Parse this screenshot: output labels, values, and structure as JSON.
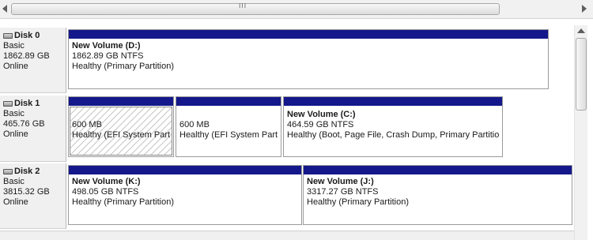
{
  "icons": {
    "scroll_grip": "grip-icon",
    "drive": "hard-disk-icon"
  },
  "hscroll": {
    "grip": "III"
  },
  "disks": [
    {
      "name": "Disk 0",
      "type": "Basic",
      "size": "1862.89 GB",
      "status": "Online",
      "partitions": [
        {
          "volume": "New Volume  (D:)",
          "size": "1862.89 GB NTFS",
          "status": "Healthy (Primary Partition)"
        }
      ]
    },
    {
      "name": "Disk 1",
      "type": "Basic",
      "size": "465.76 GB",
      "status": "Online",
      "partitions": [
        {
          "volume": "",
          "size": "600 MB",
          "status": "Healthy (EFI System Partition)",
          "selected": true
        },
        {
          "volume": "",
          "size": "600 MB",
          "status": "Healthy (EFI System Partition)"
        },
        {
          "volume": "New Volume  (C:)",
          "size": "464.59 GB NTFS",
          "status": "Healthy (Boot, Page File, Crash Dump, Primary Partition)"
        }
      ]
    },
    {
      "name": "Disk 2",
      "type": "Basic",
      "size": "3815.32 GB",
      "status": "Online",
      "partitions": [
        {
          "volume": "New Volume  (K:)",
          "size": "498.05 GB NTFS",
          "status": "Healthy (Primary Partition)"
        },
        {
          "volume": "New Volume  (J:)",
          "size": "3317.27 GB NTFS",
          "status": "Healthy (Primary Partition)"
        }
      ]
    }
  ],
  "colors": {
    "primary_partition_stripe": "#14188a",
    "label_background": "#f0f0f0"
  }
}
